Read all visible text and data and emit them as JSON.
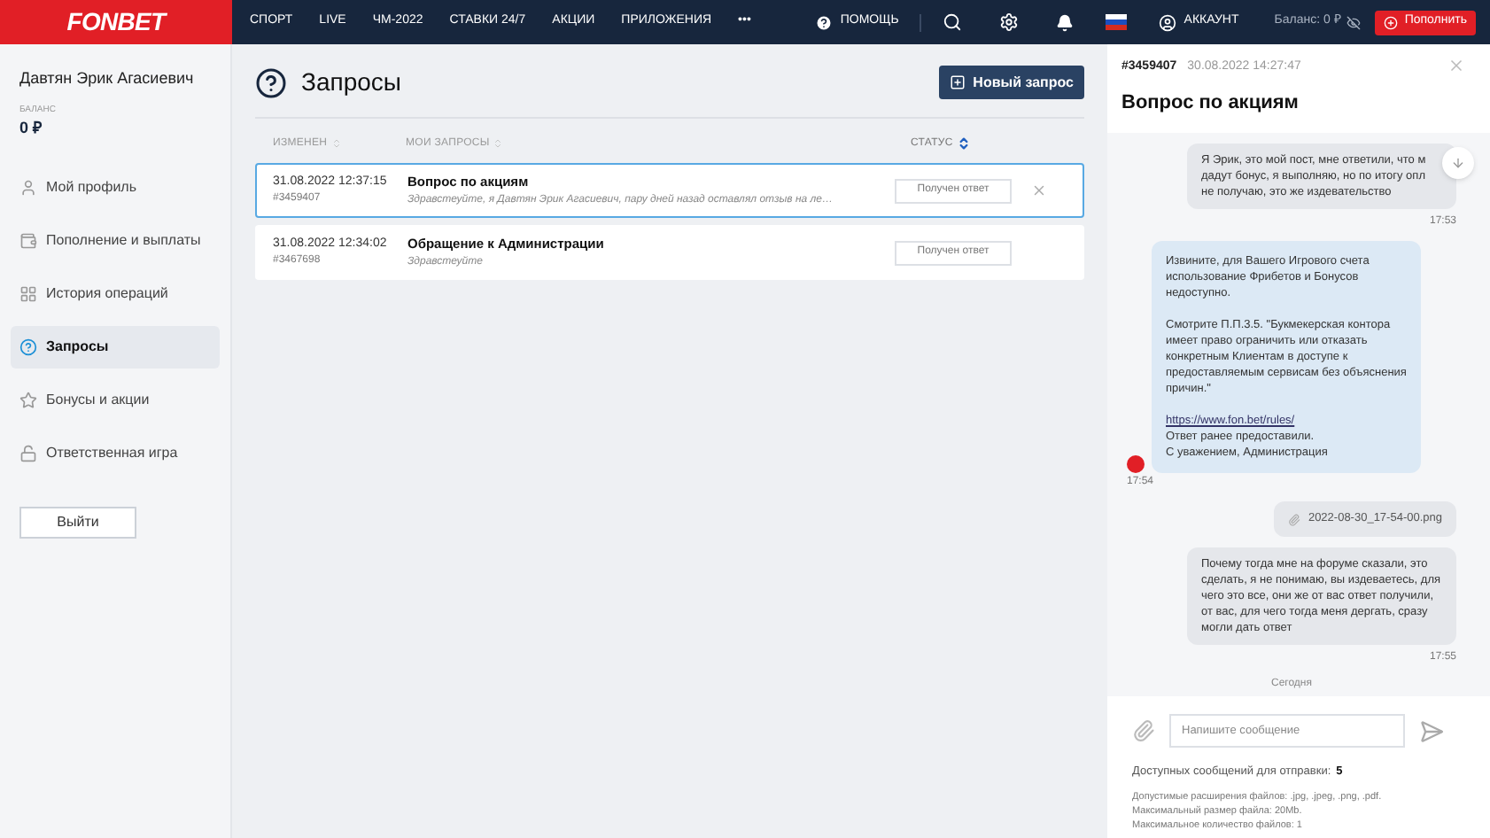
{
  "header": {
    "logo": "FONBET",
    "nav": [
      {
        "label": "СПОРТ"
      },
      {
        "label": "LIVE"
      },
      {
        "label": "ЧМ-2022"
      },
      {
        "label": "СТАВКИ 24/7"
      },
      {
        "label": "АКЦИИ"
      },
      {
        "label": "ПРИЛОЖЕНИЯ"
      },
      {
        "label": "•••"
      }
    ],
    "help": "ПОМОЩЬ",
    "account": "АККАУНТ",
    "balance": "Баланс: 0 ₽",
    "topup": "Пополнить"
  },
  "sidebar": {
    "user_name": "Давтян Эрик Агасиевич",
    "balance_label": "БАЛАНС",
    "balance": "0 ₽",
    "items": [
      {
        "label": "Мой профиль",
        "selected": false
      },
      {
        "label": "Пополнение и выплаты",
        "selected": false
      },
      {
        "label": "История операций",
        "selected": false
      },
      {
        "label": "Запросы",
        "selected": true
      },
      {
        "label": "Бонусы и акции",
        "selected": false
      },
      {
        "label": "Ответственная игра",
        "selected": false
      }
    ],
    "logout": "Выйти"
  },
  "main": {
    "title": "Запросы",
    "new_request": "Новый запрос",
    "columns": [
      {
        "label": "ИЗМЕНЕН",
        "sort_active": false
      },
      {
        "label": "МОИ ЗАПРОСЫ",
        "sort_active": false
      },
      {
        "label": "СТАТУС",
        "sort_active": true
      }
    ],
    "rows": [
      {
        "date": "31.08.2022 12:37:15",
        "id": "#3459407",
        "title": "Вопрос по акциям",
        "preview": "Здравстеуйте, я Давтян Эрик Агасиевич, пару дней назад оставлял отзыв на ле…",
        "status": "Получен ответ",
        "selected": true
      },
      {
        "date": "31.08.2022 12:34:02",
        "id": "#3467698",
        "title": "Обращение к Администрации",
        "preview": "Здравстеуйте",
        "status": "Получен ответ",
        "selected": false
      }
    ]
  },
  "chat": {
    "id": "#3459407",
    "date": "30.08.2022 14:27:47",
    "title": "Вопрос по акциям",
    "messages": [
      {
        "kind": "user",
        "lines": [
          "Я Эрик, это мой пост, мне ответили, что м",
          "дадут бонус, я выполняю, но по итогу опл",
          "не получаю, это же издевательство"
        ],
        "time": "17:53"
      },
      {
        "kind": "support",
        "blocks": [
          {
            "kind": "paragraph",
            "text": "Извините, для Вашего Игрового счета использование Фрибетов и Бонусов недоступно."
          },
          {
            "kind": "paragraph",
            "text": "Смотрите П.П.3.5. \"Букмекерская контора имеет право ограничить или отказать конкретным Клиентам в доступе к предоставляемым сервисам без объяснения причин.\""
          },
          {
            "kind": "link",
            "text": "https://www.fon.bet/rules/"
          },
          {
            "kind": "line",
            "text": "Ответ ранее предоставили."
          },
          {
            "kind": "line",
            "text": "С уважением, Администрация"
          }
        ],
        "time": "17:54"
      },
      {
        "kind": "file",
        "name": "2022-08-30_17-54-00.png"
      },
      {
        "kind": "user",
        "lines": [
          "Почему тогда мне на форуме сказали, это сделать, я не понимаю, вы издеваетесь, для чего это все, они же от вас ответ получили, от вас, для чего тогда меня дергать, сразу могли дать ответ"
        ],
        "time": "17:55"
      },
      {
        "kind": "separator",
        "text": "Сегодня"
      }
    ],
    "input": {
      "placeholder": "Напишите сообщение"
    },
    "available_label": "Доступных сообщений для отправки:",
    "available_count": "5",
    "notes": [
      "Допустимые расширения файлов: .jpg, .jpeg, .png, .pdf.",
      "Максимальный размер файла: 20Mb.",
      "Максимальное количество файлов: 1"
    ]
  }
}
